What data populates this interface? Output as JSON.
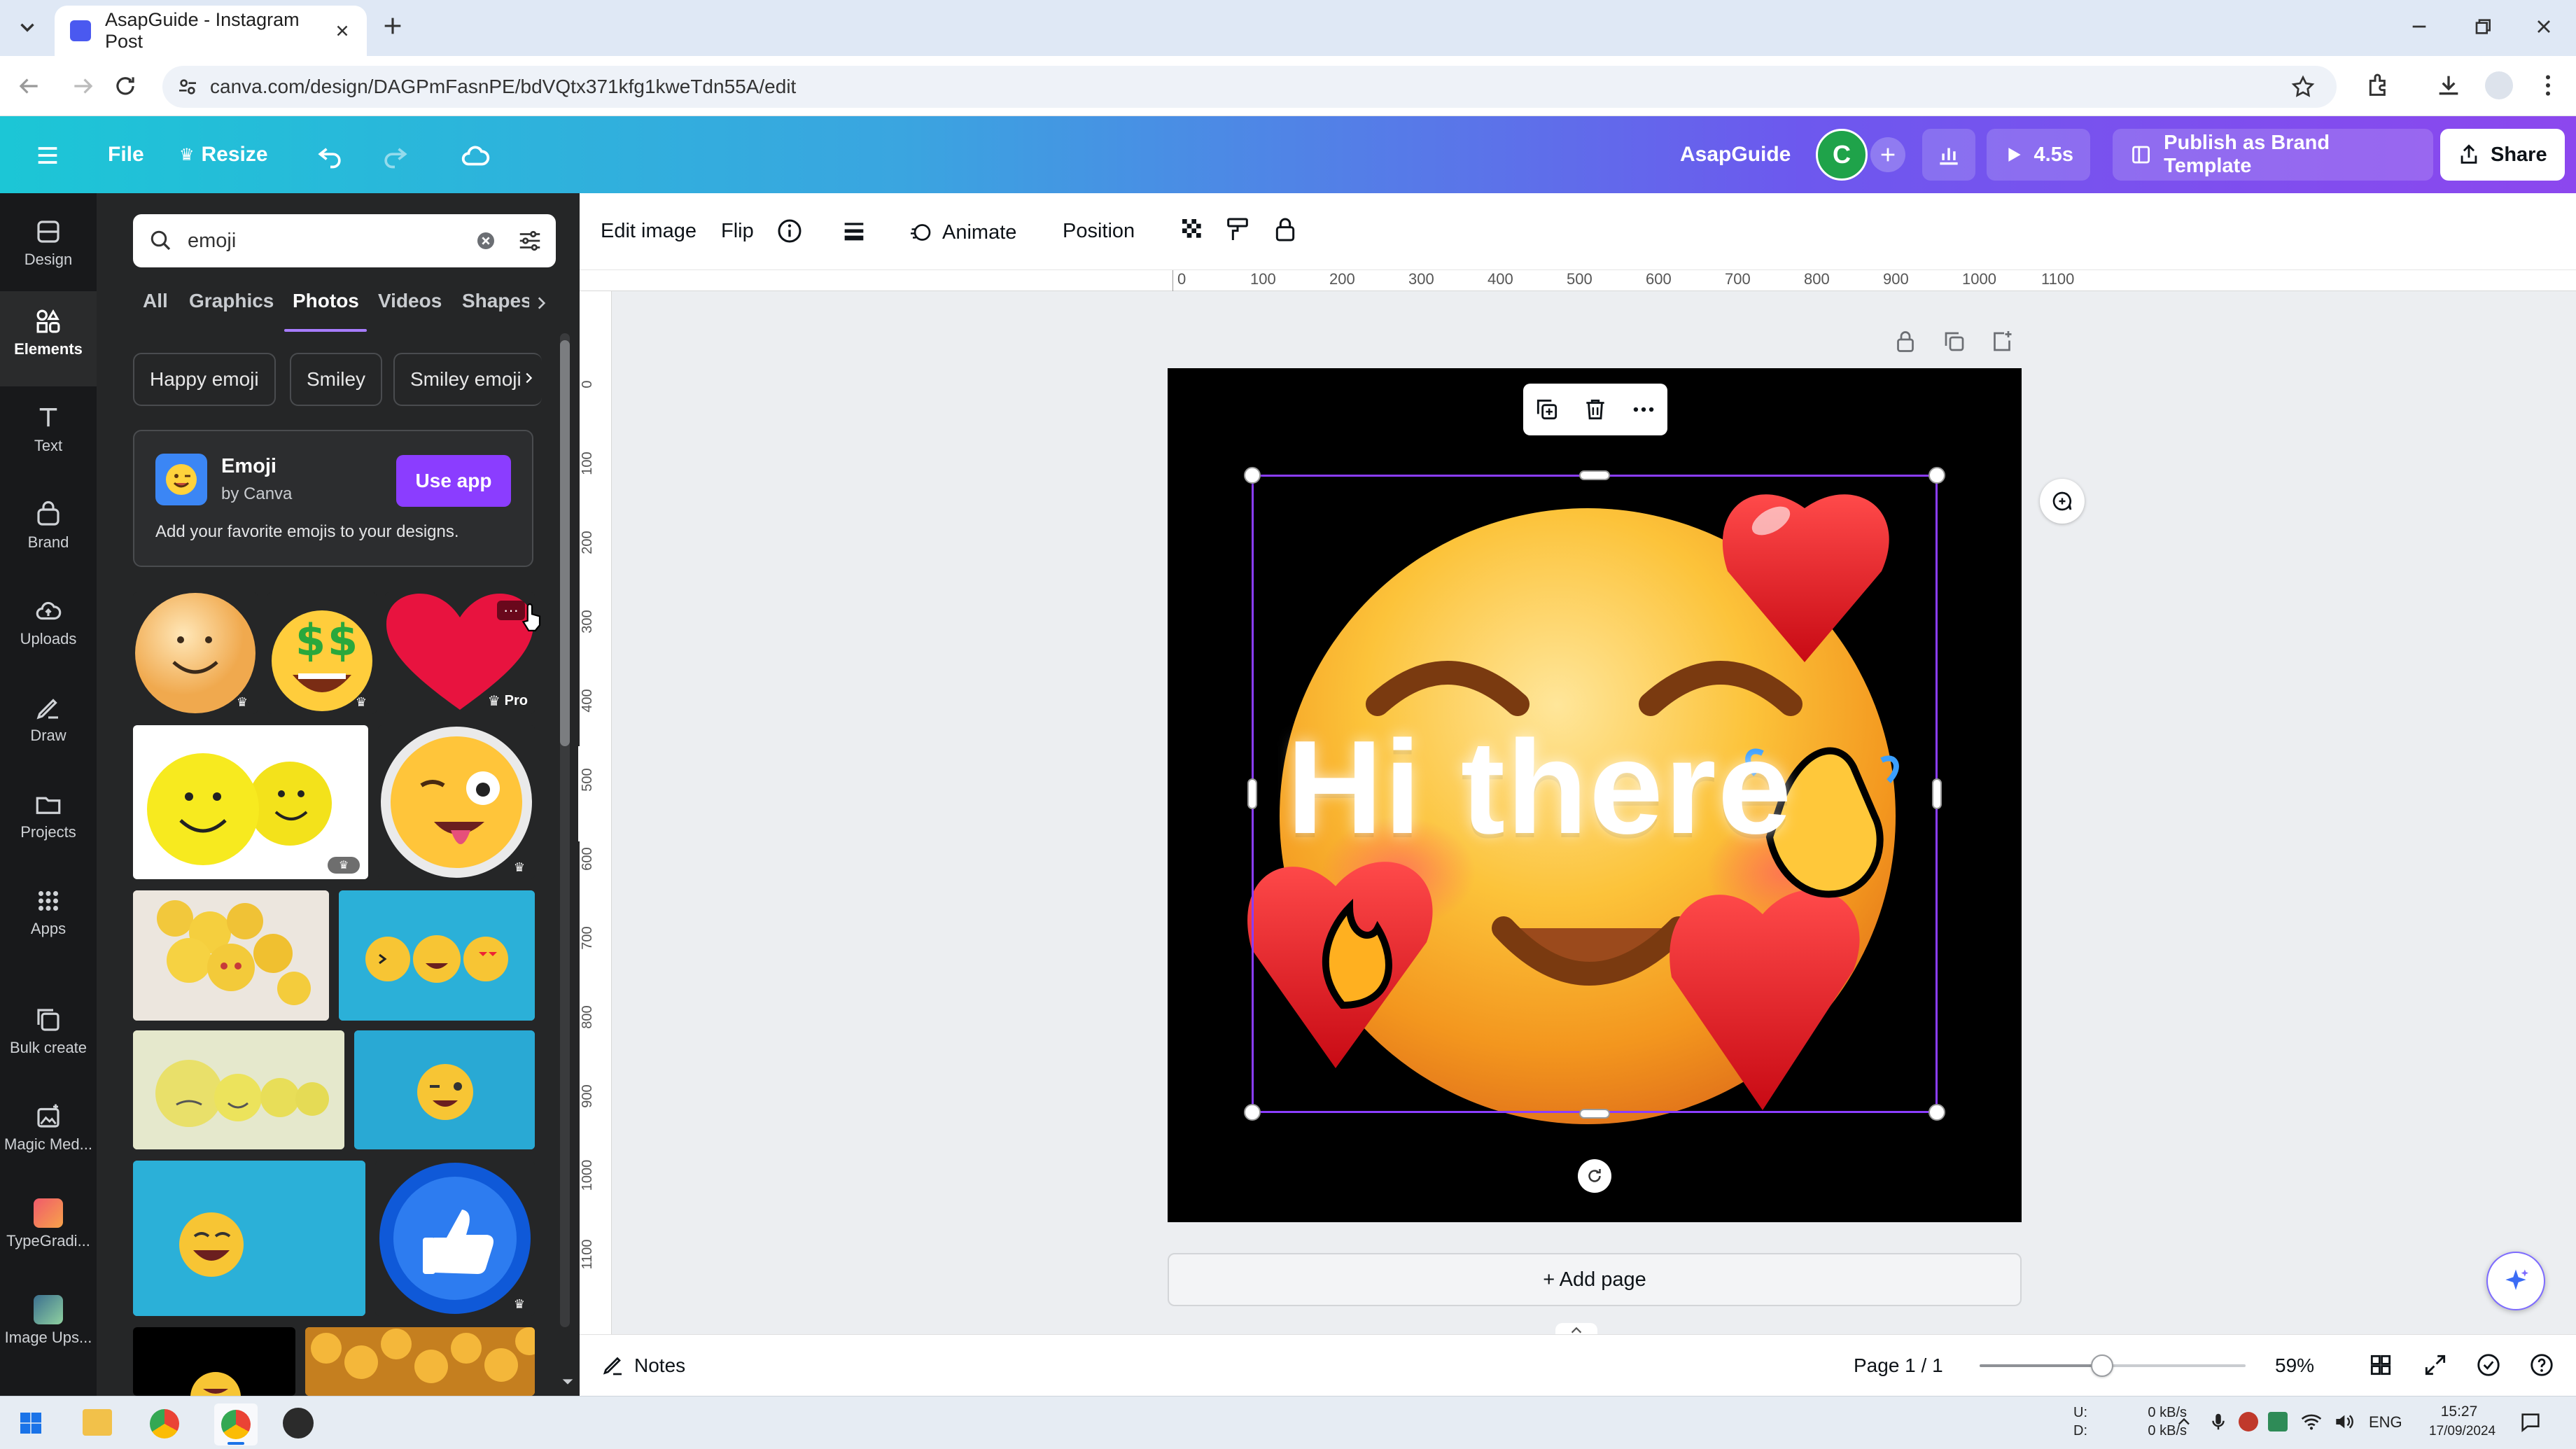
{
  "browser": {
    "tab_title": "AsapGuide - Instagram Post",
    "url": "canva.com/design/DAGPmFasnPE/bdVQtx371kfg1kweTdn55A/edit"
  },
  "topbar": {
    "file": "File",
    "resize": "Resize",
    "team_name": "AsapGuide",
    "avatar_letter": "C",
    "present_time": "4.5s",
    "publish": "Publish as Brand Template",
    "share": "Share"
  },
  "rail": {
    "items": [
      "Design",
      "Elements",
      "Text",
      "Brand",
      "Uploads",
      "Draw",
      "Projects",
      "Apps",
      "Bulk create",
      "Magic Med...",
      "TypeGradi...",
      "Image Ups..."
    ]
  },
  "panel": {
    "search_value": "emoji",
    "tabs": [
      "All",
      "Graphics",
      "Photos",
      "Videos",
      "Shapes"
    ],
    "active_tab": "Photos",
    "chips": [
      "Happy emoji",
      "Smiley",
      "Smiley emoji"
    ],
    "app": {
      "name": "Emoji",
      "by": "by Canva",
      "button": "Use app",
      "description": "Add your favorite emojis to your designs."
    },
    "pro_badge": "Pro"
  },
  "toolbar": {
    "edit_image": "Edit image",
    "flip": "Flip",
    "animate": "Animate",
    "position": "Position"
  },
  "ruler": {
    "ticks": [
      "0",
      "100",
      "200",
      "300",
      "400",
      "500",
      "600",
      "700",
      "800",
      "900",
      "1000",
      "1100"
    ],
    "vticks": [
      "0",
      "100",
      "200",
      "300",
      "400",
      "500",
      "600",
      "700",
      "800",
      "900",
      "1000",
      "1100"
    ]
  },
  "canvas": {
    "text": "Hi there",
    "add_page": "+ Add page"
  },
  "bottombar": {
    "notes": "Notes",
    "page": "Page 1 / 1",
    "zoom": "59%",
    "zoom_fraction": 0.46
  },
  "taskbar": {
    "net_up": "0 kB/s",
    "net_down": "0 kB/s",
    "net_u_label": "U:",
    "net_d_label": "D:",
    "lang": "ENG",
    "time": "15:27",
    "date": "17/09/2024"
  },
  "colors": {
    "accent_purple": "#8b3dff",
    "canvas_bg": "#000000",
    "rail_bg": "#18191b",
    "panel_bg": "#252627"
  }
}
